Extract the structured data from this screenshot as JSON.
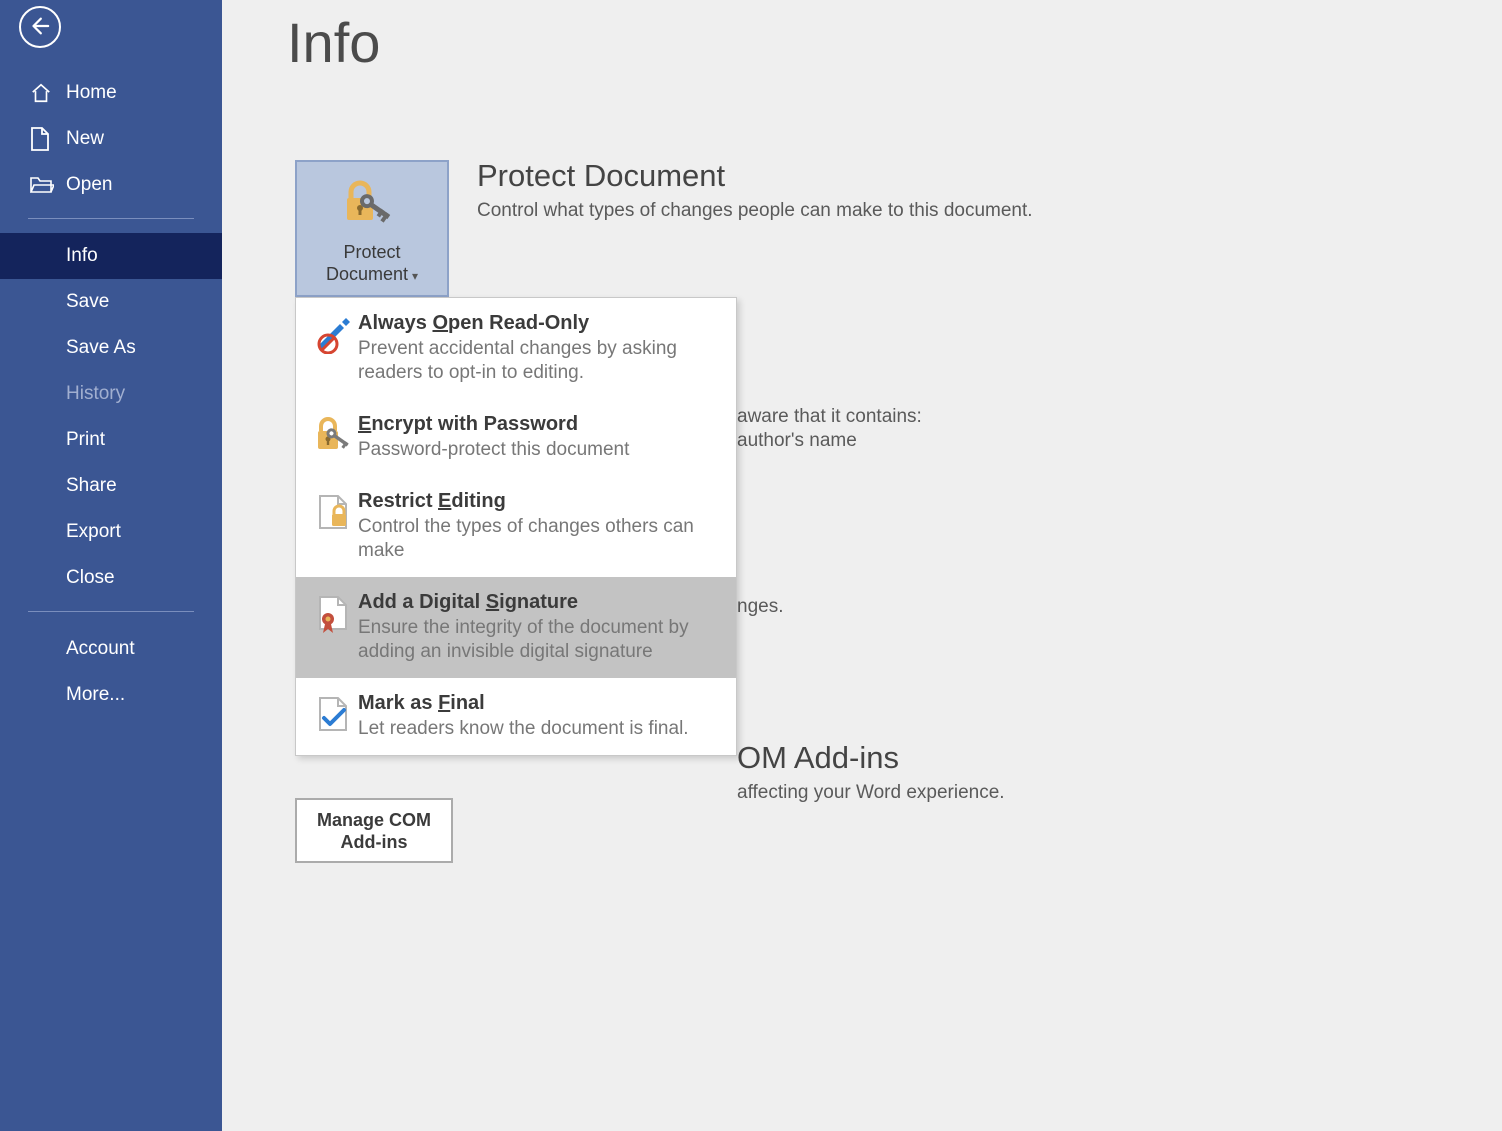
{
  "sidebar": {
    "back": "Back",
    "items": [
      {
        "icon": "home",
        "label": "Home"
      },
      {
        "icon": "new",
        "label": "New"
      },
      {
        "icon": "open",
        "label": "Open"
      }
    ],
    "file_items": [
      {
        "label": "Info",
        "active": true
      },
      {
        "label": "Save"
      },
      {
        "label": "Save As"
      },
      {
        "label": "History",
        "disabled": true
      },
      {
        "label": "Print"
      },
      {
        "label": "Share"
      },
      {
        "label": "Export"
      },
      {
        "label": "Close"
      }
    ],
    "account_items": [
      {
        "label": "Account"
      },
      {
        "label": "More..."
      }
    ]
  },
  "page": {
    "title": "Info"
  },
  "protect": {
    "button": "Protect Document",
    "heading": "Protect Document",
    "body": "Control what types of changes people can make to this document."
  },
  "inspect": {
    "line1": "aware that it contains:",
    "line2": "author's name"
  },
  "manage": {
    "body": "nges."
  },
  "com": {
    "heading": "OM Add-ins",
    "body": "affecting your Word experience.",
    "button": "Manage COM Add-ins"
  },
  "dropdown": {
    "items": [
      {
        "title": "Always Open Read-Only",
        "mnem": "O",
        "desc": "Prevent accidental changes by asking readers to opt-in to editing.",
        "icon": "readonly"
      },
      {
        "title": "Encrypt with Password",
        "mnem": "E",
        "desc": "Password-protect this document",
        "icon": "encrypt"
      },
      {
        "title": "Restrict Editing",
        "mnem": "E",
        "desc": "Control the types of changes others can make",
        "icon": "restrict"
      },
      {
        "title": "Add a Digital Signature",
        "mnem": "S",
        "desc": "Ensure the integrity of the document by adding an invisible digital signature",
        "icon": "sign",
        "hover": true
      },
      {
        "title": "Mark as Final",
        "mnem": "F",
        "desc": "Let readers know the document is final.",
        "icon": "final"
      }
    ]
  }
}
